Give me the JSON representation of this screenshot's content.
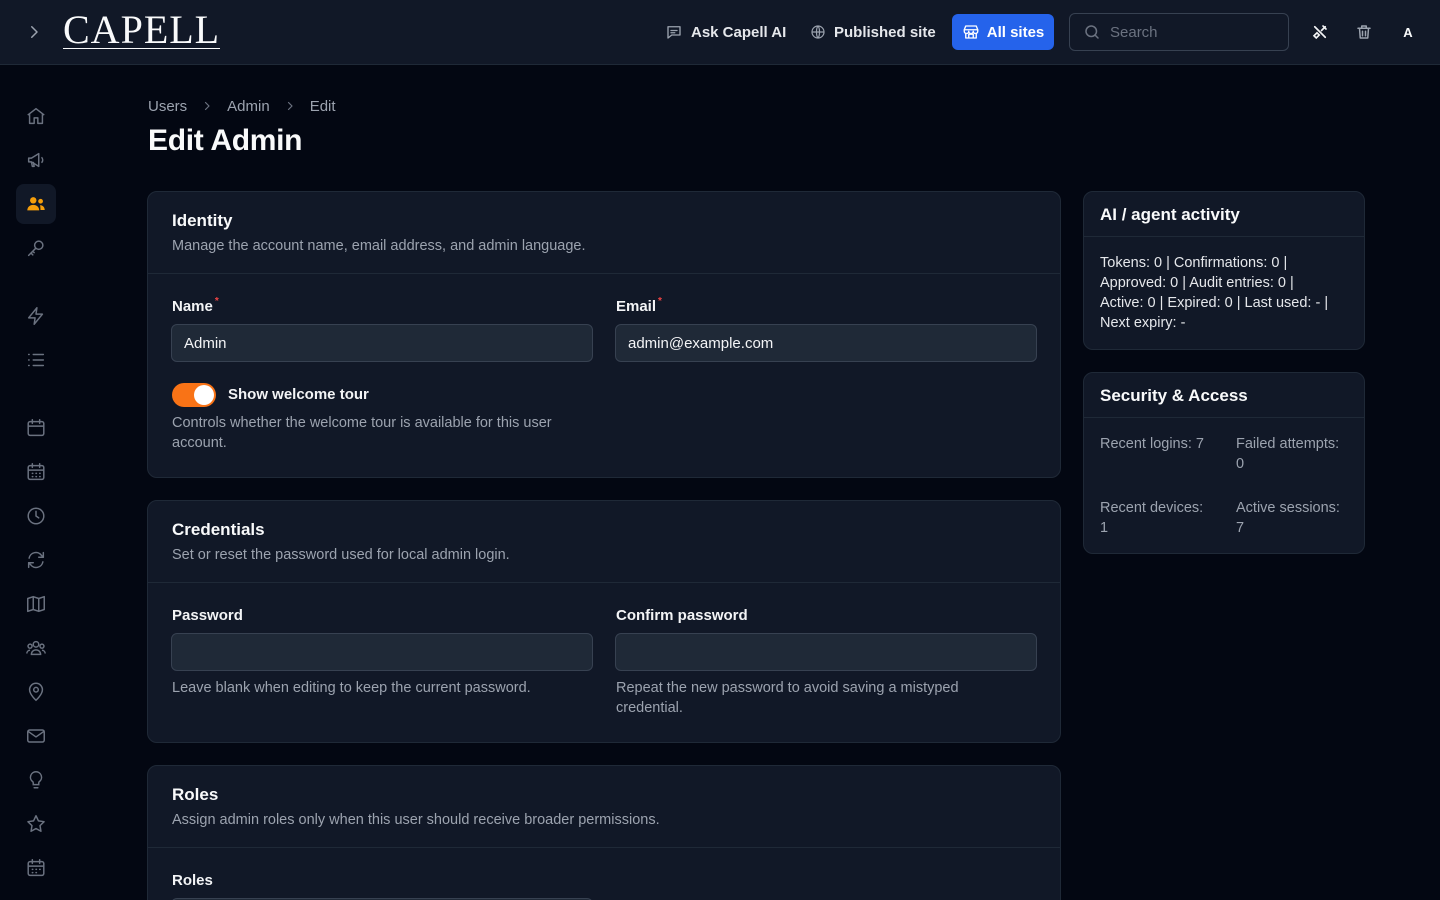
{
  "header": {
    "logo": "CAPELL",
    "ask_ai": "Ask Capell AI",
    "published_site": "Published site",
    "all_sites": "All sites",
    "search_placeholder": "Search",
    "avatar": "A"
  },
  "sidebar": {
    "items": [
      {
        "icon": "home-icon"
      },
      {
        "icon": "megaphone-icon"
      },
      {
        "icon": "users-icon",
        "active": true
      },
      {
        "icon": "key-icon"
      },
      {
        "icon": "bolt-icon"
      },
      {
        "icon": "list-icon"
      },
      {
        "icon": "calendar-icon"
      },
      {
        "icon": "calendar-days-icon"
      },
      {
        "icon": "clock-icon"
      },
      {
        "icon": "refresh-icon"
      },
      {
        "icon": "map-icon"
      },
      {
        "icon": "user-group-icon"
      },
      {
        "icon": "map-pin-icon"
      },
      {
        "icon": "envelope-icon"
      },
      {
        "icon": "light-bulb-icon"
      },
      {
        "icon": "star-icon"
      },
      {
        "icon": "calendar-grid-icon"
      }
    ],
    "active_color": "#f59e0b"
  },
  "breadcrumb": [
    "Users",
    "Admin",
    "Edit"
  ],
  "page_title": "Edit Admin",
  "identity": {
    "title": "Identity",
    "description": "Manage the account name, email address, and admin language.",
    "name_label": "Name",
    "name_value": "Admin",
    "email_label": "Email",
    "email_value": "admin@example.com",
    "required_marker": "*",
    "toggle_label": "Show welcome tour",
    "toggle_on": true,
    "toggle_hint_line1": "Controls whether the welcome tour is available for this user",
    "toggle_hint_line2": "account."
  },
  "credentials": {
    "title": "Credentials",
    "description": "Set or reset the password used for local admin login.",
    "password_label": "Password",
    "password_value": "",
    "password_hint": "Leave blank when editing to keep the current password.",
    "confirm_label": "Confirm password",
    "confirm_value": "",
    "confirm_hint_line1": "Repeat the new password to avoid saving a mistyped",
    "confirm_hint_line2": "credential."
  },
  "roles": {
    "title": "Roles",
    "description": "Assign admin roles only when this user should receive broader permissions.",
    "roles_label": "Roles"
  },
  "ai_activity": {
    "title": "AI / agent activity",
    "line1": "Tokens: 0 | Confirmations: 0 |",
    "line2": "Approved: 0 | Audit entries: 0 |",
    "line3": "Active: 0 | Expired: 0 | Last used: - |",
    "line4": "Next expiry: -"
  },
  "security": {
    "title": "Security & Access",
    "recent_logins": "Recent logins: 7",
    "failed_attempts_label": "Failed attempts:",
    "failed_attempts_value": "0",
    "recent_devices_label": "Recent devices:",
    "recent_devices_value": "1",
    "active_sessions_label": "Active sessions:",
    "active_sessions_value": "7"
  },
  "colors": {
    "background": "#030712",
    "surface": "#111827",
    "accent_blue": "#2563eb",
    "toggle_orange": "#f97316",
    "required_red": "#ef4444"
  }
}
